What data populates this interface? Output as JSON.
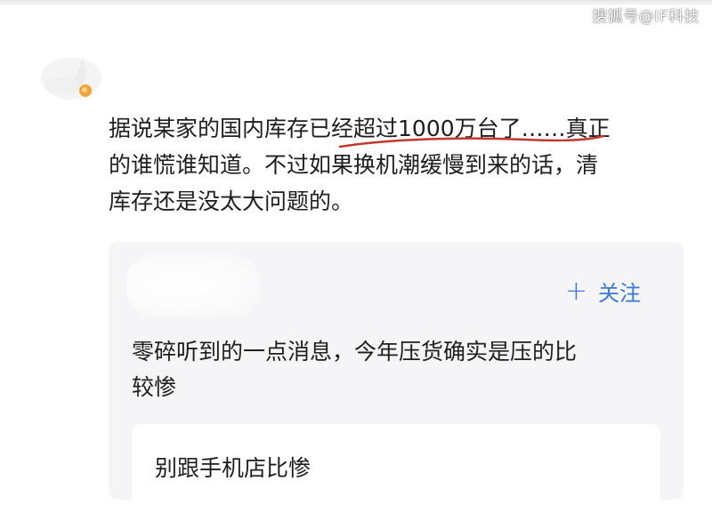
{
  "watermark": "搜狐号@IF科技",
  "post": {
    "lines": [
      "据说某家的国内库存已经超过1000万台了……真正",
      "的谁慌谁知道。不过如果换机潮缓慢到来的话，清",
      "库存还是没太大问题的。"
    ]
  },
  "quote": {
    "follow_label": "关注",
    "lines": [
      "零碎听到的一点消息，今年压货确实是压的比",
      "较惨"
    ],
    "reply": "别跟手机店比惨"
  },
  "colors": {
    "accent": "#3a78d6",
    "underline": "#c0392b",
    "card_bg": "#f5f5f7"
  }
}
